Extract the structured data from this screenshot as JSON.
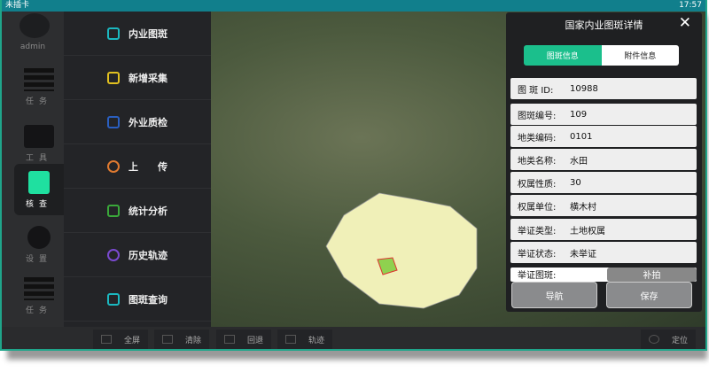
{
  "status_bar": {
    "carrier": "未插卡",
    "time": "17:57"
  },
  "rail": {
    "user": "admin",
    "items": [
      {
        "label": "任务",
        "icon": "layers-icon"
      },
      {
        "label": "工具",
        "icon": "toolbox-icon"
      },
      {
        "label": "核查",
        "icon": "clipboard-check-icon",
        "active": true
      },
      {
        "label": "设置",
        "icon": "gear-icon"
      },
      {
        "label": "任务",
        "icon": "layers-icon"
      }
    ]
  },
  "menu": {
    "items": [
      {
        "label": "内业图斑",
        "color": "#1bb8c0"
      },
      {
        "label": "新增采集",
        "color": "#e0c020"
      },
      {
        "label": "外业质检",
        "color": "#2a5fc0"
      },
      {
        "label": "上　　传",
        "color": "#e07a30"
      },
      {
        "label": "统计分析",
        "color": "#3aa83a"
      },
      {
        "label": "历史轨迹",
        "color": "#7a4ad0"
      },
      {
        "label": "图斑查询",
        "color": "#1bb8c0"
      }
    ]
  },
  "panel": {
    "title": "国家内业图斑详情",
    "tabs": [
      "图斑信息",
      "附件信息"
    ],
    "rows": [
      {
        "k": "图 斑 ID:",
        "v": "10988"
      },
      {
        "k": "图斑编号:",
        "v": "109"
      },
      {
        "k": "地类编码:",
        "v": "0101"
      },
      {
        "k": "地类名称:",
        "v": "水田"
      },
      {
        "k": "权属性质:",
        "v": "30"
      },
      {
        "k": "权属单位:",
        "v": "横木村"
      },
      {
        "k": "举证类型:",
        "v": "土地权属"
      },
      {
        "k": "举证状态:",
        "v": "未举证"
      }
    ],
    "partial_label": "举证图斑:",
    "partial_button": "补拍",
    "nav": "导航",
    "save": "保存"
  },
  "toolbar": {
    "fullscreen": "全屏",
    "clear": "清除",
    "back": "回退",
    "track": "轨迹",
    "locate": "定位"
  },
  "colors": {
    "accent": "#1bbf8c",
    "status_bar": "#117f8c"
  }
}
